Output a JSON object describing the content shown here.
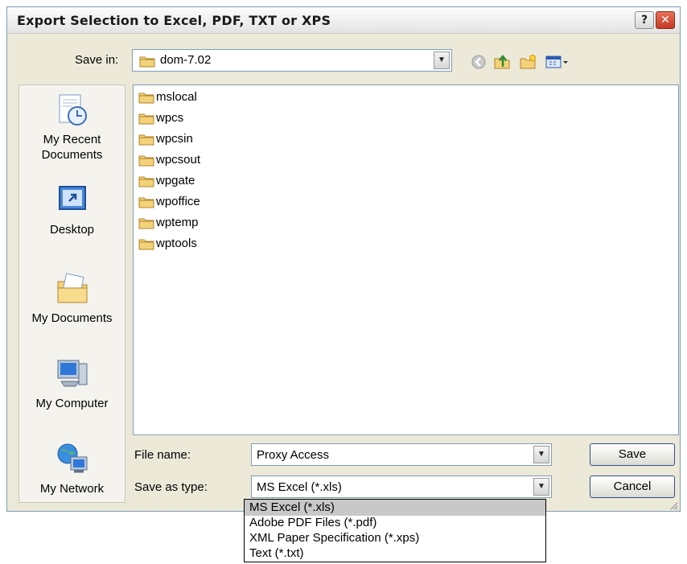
{
  "dialog": {
    "title": "Export Selection to Excel, PDF, TXT or XPS",
    "help_label": "?",
    "close_label": "✕"
  },
  "save_in": {
    "label": "Save in:",
    "value": "dom-7.02"
  },
  "places": [
    {
      "label": "My Recent\nDocuments",
      "icon": "recent-documents-icon"
    },
    {
      "label": "Desktop",
      "icon": "desktop-icon"
    },
    {
      "label": "My Documents",
      "icon": "my-documents-icon"
    },
    {
      "label": "My Computer",
      "icon": "my-computer-icon"
    },
    {
      "label": "My Network",
      "icon": "my-network-icon"
    }
  ],
  "folders": [
    "mslocal",
    "wpcs",
    "wpcsin",
    "wpcsout",
    "wpgate",
    "wpoffice",
    "wptemp",
    "wptools"
  ],
  "file_name": {
    "label": "File name:",
    "value": "Proxy Access"
  },
  "save_as_type": {
    "label": "Save as type:",
    "value": "MS Excel (*.xls)",
    "options": [
      "MS Excel (*.xls)",
      "Adobe PDF Files (*.pdf)",
      "XML Paper Specification (*.xps)",
      "Text (*.txt)"
    ],
    "selected_index": 0
  },
  "buttons": {
    "save": "Save",
    "cancel": "Cancel"
  }
}
